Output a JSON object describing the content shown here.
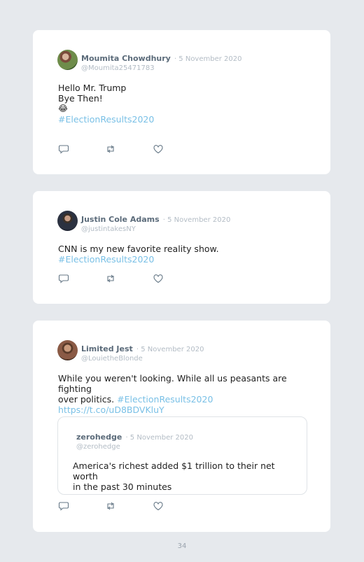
{
  "tweets": [
    {
      "name": "Moumita Chowdhury",
      "date": "· 5 November 2020",
      "handle": "@Moumita25471783",
      "line1": "Hello Mr. Trump",
      "line2": "Bye Then!",
      "emoji": "😂",
      "hashtag": "#ElectionResults2020",
      "avatar_icon": "profile-photo"
    },
    {
      "name": "Justin Cole Adams",
      "date": "· 5 November 2020",
      "handle": "@justintakesNY",
      "text": "CNN is my new favorite reality show.",
      "hashtag": "#ElectionResults2020",
      "avatar_icon": "profile-photo"
    },
    {
      "name": "Limited Jest",
      "date": "· 5 November 2020",
      "handle": "@LouietheBlonde",
      "text_line1": "While you weren't looking. While all us peasants are fighting",
      "text_line2": "over politics.",
      "hashtag": "#ElectionResults2020",
      "link": "https://t.co/uD8BDVKluY",
      "avatar_icon": "profile-photo",
      "quote": {
        "name": "zerohedge",
        "date": "· 5 November 2020",
        "handle": "@zerohedge",
        "line1": "America's richest added $1 trillion to their net worth",
        "line2": "in the past 30 minutes"
      }
    }
  ],
  "action_icons": [
    "reply-icon",
    "retweet-icon",
    "like-icon"
  ],
  "page_number": "34",
  "colors": {
    "background": "#e6e9ed",
    "card": "#ffffff",
    "hashtag": "#79c0e6",
    "name": "#5b6b7a",
    "muted": "#b3bcc5"
  }
}
